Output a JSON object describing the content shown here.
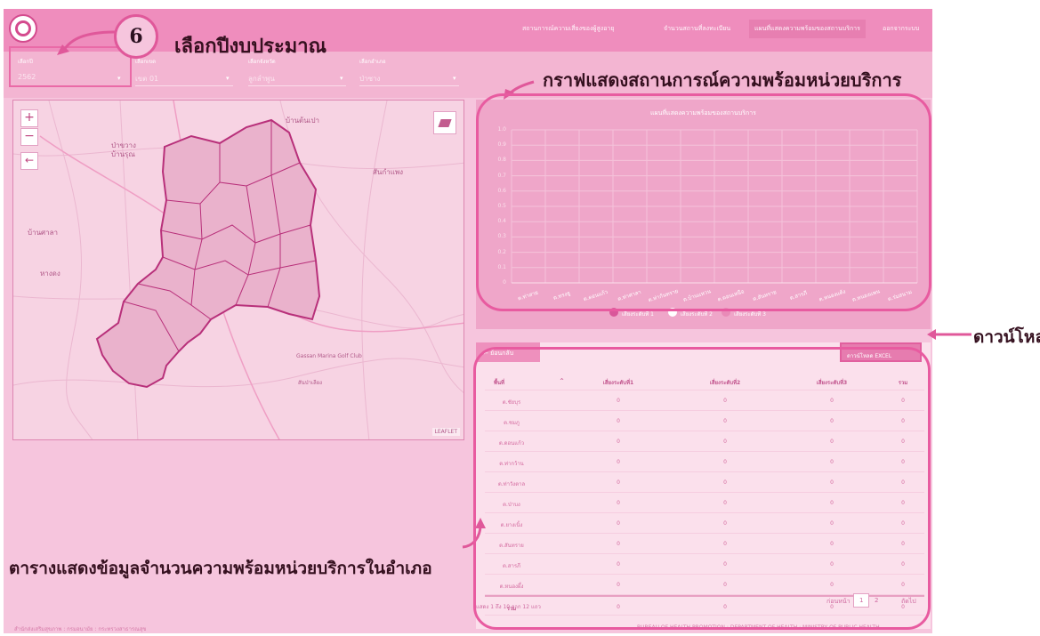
{
  "nav": {
    "items": [
      "สถานการณ์ความเสี่ยงของผู้สูงอายุ",
      "จำนวนสถานที่ลงทะเบียน",
      "แผนที่แสดงความพร้อมของสถานบริการ",
      "ออกจากระบบ"
    ],
    "active_index": 2
  },
  "filters": [
    {
      "label": "เลือกปี",
      "value": "2562"
    },
    {
      "label": "เลือกเขต",
      "value": "เขต 01"
    },
    {
      "label": "เลือกจังหวัด",
      "value": "ลูกลำพูน"
    },
    {
      "label": "เลือกอำเภอ",
      "value": "ป่าซาง"
    }
  ],
  "annotations": {
    "step_number": "6",
    "step_label": "เลือกปีงบประมาณ",
    "chart_label": "กราฟแสดงสถานการณ์ความพร้อมหน่วยบริการ",
    "download_label": "ดาวน์โหลด",
    "table_label": "ตารางแสดงข้อมูลจำนวนความพร้อมหน่วยบริการในอำเภอ"
  },
  "map": {
    "places": [
      "บ้านต้นเปา",
      "ป่าขวาง",
      "บ้านรุณ",
      "สันกำแพง",
      "บ้านศาลา",
      "หางดง",
      "Gassan Marina Golf Club",
      "สันป่าเลียง"
    ],
    "attribution": "LEAFLET",
    "zoom_in": "+",
    "zoom_out": "−",
    "back": "←"
  },
  "chart_data": {
    "type": "bar",
    "title": "แผนที่แสดงความพร้อมของสถานบริการ",
    "ylim": [
      0,
      1
    ],
    "yticks": [
      "0",
      "0.1",
      "0.2",
      "0.3",
      "0.4",
      "0.5",
      "0.6",
      "0.7",
      "0.8",
      "0.9",
      "1.0"
    ],
    "categories": [
      "ต.ท่าสาย",
      "ต.ทรงธู",
      "ต.ดอนแก้ว",
      "ต.ท่าศาลา",
      "ต.ท่ากันทราย",
      "ต.บ้านแหวน",
      "ต.ดอนเหนือ",
      "ต.สันทราย",
      "ต.สารภี",
      "ต.หนองแต้ง",
      "ต.หนองแพน",
      "ต.ร่มสนาม"
    ],
    "series": [
      {
        "name": "เสี่ยงระดับที่ 1",
        "values": [
          0,
          0,
          0,
          0,
          0,
          0,
          0,
          0,
          0,
          0,
          0,
          0
        ],
        "color": "#d9579a"
      },
      {
        "name": "เสี่ยงระดับที่ 2",
        "values": [
          0,
          0,
          0,
          0,
          0,
          0,
          0,
          0,
          0,
          0,
          0,
          0
        ],
        "color": "#ffffff"
      },
      {
        "name": "เสี่ยงระดับที่ 3",
        "values": [
          0,
          0,
          0,
          0,
          0,
          0,
          0,
          0,
          0,
          0,
          0,
          0
        ],
        "color": "#e98bb8"
      }
    ],
    "grid": true,
    "legend": "bottom"
  },
  "table": {
    "back_label": "ย้อนกลับ",
    "excel_label": "ดาวน์โหลด EXCEL",
    "headers": [
      "พื้นที่",
      "เสี่ยงระดับที่1",
      "เสี่ยงระดับที่2",
      "เสี่ยงระดับที่3",
      "รวม"
    ],
    "rows": [
      [
        "ต.ชัยบุร",
        "0",
        "0",
        "0",
        "0"
      ],
      [
        "ต.ชมภู",
        "0",
        "0",
        "0",
        "0"
      ],
      [
        "ต.ดอนแก้ว",
        "0",
        "0",
        "0",
        "0"
      ],
      [
        "ต.ท่ากว้าน",
        "0",
        "0",
        "0",
        "0"
      ],
      [
        "ต.ท่าวังตาล",
        "0",
        "0",
        "0",
        "0"
      ],
      [
        "ต.ป่าบง",
        "0",
        "0",
        "0",
        "0"
      ],
      [
        "ต.ยางเนิ้ง",
        "0",
        "0",
        "0",
        "0"
      ],
      [
        "ต.สันทราย",
        "0",
        "0",
        "0",
        "0"
      ],
      [
        "ต.สารภี",
        "0",
        "0",
        "0",
        "0"
      ],
      [
        "ต.หนองผึ้ง",
        "0",
        "0",
        "0",
        "0"
      ]
    ],
    "total": [
      "รวม",
      "0",
      "0",
      "0",
      "0"
    ],
    "pager_info": "แสดง 1 ถึง 10 จาก 12 แถว",
    "prev_label": "ก่อนหน้า",
    "pages": [
      "1",
      "2"
    ],
    "next_label": "ถัดไป"
  },
  "footer": {
    "left": "สำนักส่งเสริมสุขภาพ : กรมอนามัย : กระทรวงสาธารณสุข",
    "right": "BUREAU OF HEALTH PROMOTION : DEPARTMENT OF HEALTH : MINISTRY OF PUBLIC HEALTH"
  }
}
